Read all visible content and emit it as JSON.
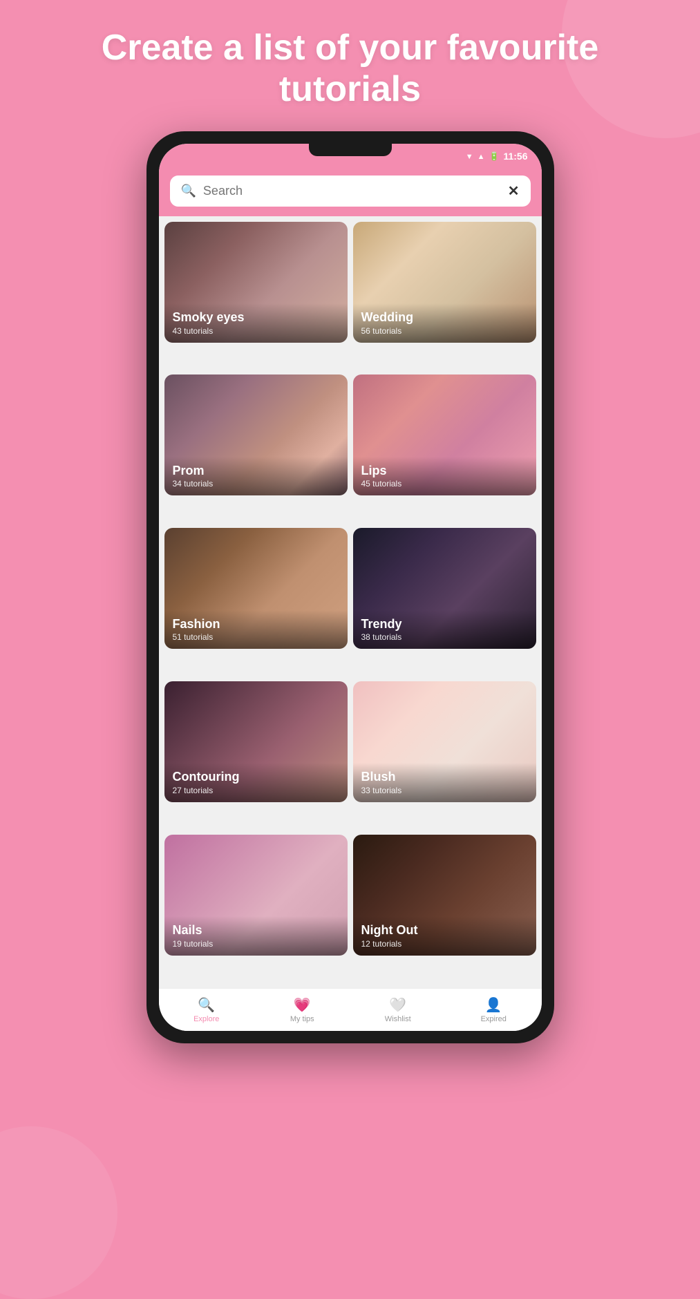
{
  "hero": {
    "title": "Create a list of your favourite tutorials"
  },
  "statusBar": {
    "time": "11:56"
  },
  "search": {
    "placeholder": "Search"
  },
  "categories": [
    {
      "id": "smoky-eyes",
      "title": "Smoky eyes",
      "subtitle": "43 tutorials",
      "bgClass": "smoky-bg"
    },
    {
      "id": "wedding",
      "title": "Wedding",
      "subtitle": "56 tutorials",
      "bgClass": "wedding-bg"
    },
    {
      "id": "prom",
      "title": "Prom",
      "subtitle": "34 tutorials",
      "bgClass": "prom-bg"
    },
    {
      "id": "lips",
      "title": "Lips",
      "subtitle": "45 tutorials",
      "bgClass": "lips-bg"
    },
    {
      "id": "fashion",
      "title": "Fashion",
      "subtitle": "51 tutorials",
      "bgClass": "fashion-bg"
    },
    {
      "id": "trendy",
      "title": "Trendy",
      "subtitle": "38 tutorials",
      "bgClass": "trendy-bg"
    },
    {
      "id": "contouring",
      "title": "Contouring",
      "subtitle": "27 tutorials",
      "bgClass": "contouring-bg"
    },
    {
      "id": "blush",
      "title": "Blush",
      "subtitle": "33 tutorials",
      "bgClass": "blush-bg"
    },
    {
      "id": "nails",
      "title": "Nails",
      "subtitle": "19 tutorials",
      "bgClass": "nails-bg"
    },
    {
      "id": "night-out",
      "title": "Night Out",
      "subtitle": "12 tutorials",
      "bgClass": "nightout-bg"
    }
  ],
  "bottomNav": [
    {
      "id": "explore",
      "label": "Explore",
      "icon": "🔍",
      "active": true
    },
    {
      "id": "my-tips",
      "label": "My tips",
      "icon": "💗",
      "active": false
    },
    {
      "id": "wishlist",
      "label": "Wishlist",
      "icon": "🤍",
      "active": false
    },
    {
      "id": "expired",
      "label": "Expired",
      "icon": "👤",
      "active": false
    }
  ]
}
